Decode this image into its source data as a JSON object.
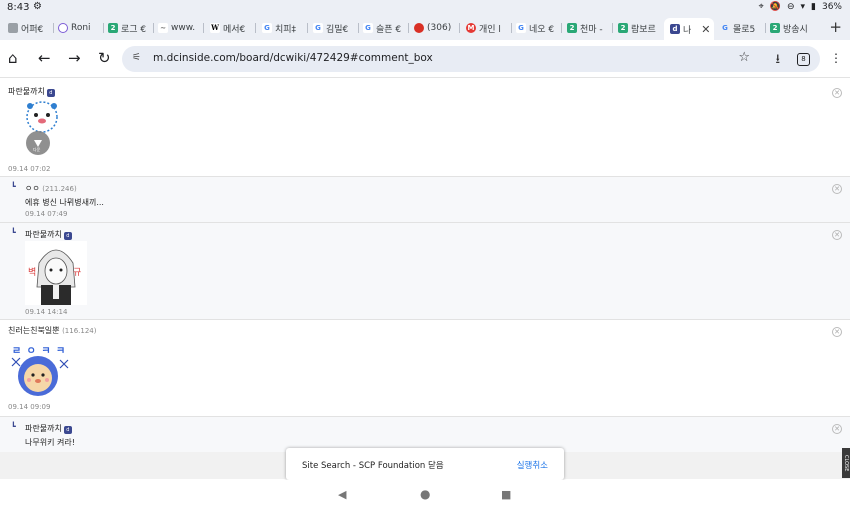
{
  "status": {
    "time": "8:43",
    "battery": "36%"
  },
  "tabs": [
    {
      "label": "어퍼€",
      "color": "#8a8a8a"
    },
    {
      "label": "Roni",
      "color": "#7c5cd6"
    },
    {
      "label": "로그 €",
      "color": "#2aa876"
    },
    {
      "label": "www.",
      "color": "#666666"
    },
    {
      "label": "메서€",
      "color": "#000000"
    },
    {
      "label": "치피‡",
      "color": "#4285f4"
    },
    {
      "label": "김밀€",
      "color": "#4285f4"
    },
    {
      "label": "슬픈 €",
      "color": "#4285f4"
    },
    {
      "label": "(306)",
      "color": "#d93025"
    },
    {
      "label": "개인 l",
      "color": "#ff5722"
    },
    {
      "label": "네오 €",
      "color": "#4285f4"
    },
    {
      "label": "천마 -",
      "color": "#2aa876"
    },
    {
      "label": "람보르",
      "color": "#2aa876"
    },
    {
      "label": "나",
      "color": "#3b4890"
    },
    {
      "label": "몰로5",
      "color": "#4285f4"
    },
    {
      "label": "방송시",
      "color": "#2aa876"
    }
  ],
  "toolbar": {
    "url": "m.dcinside.com/board/dcwiki/472429#comment_box",
    "tab_count": "8"
  },
  "comments": [
    {
      "nick": "파란물까치",
      "ip": "",
      "date": "09.14 07:02",
      "body": "",
      "reply": false
    },
    {
      "nick": "ㅇㅇ",
      "ip": "(211.246)",
      "date": "09.14 07:49",
      "body": "에휴 병신 나뮈병새끼...",
      "reply": true
    },
    {
      "nick": "파란물까치",
      "ip": "",
      "date": "09.14 14:14",
      "body": "",
      "reply": true
    },
    {
      "nick": "친러는친북일뿐",
      "ip": "(116.124)",
      "date": "09.14 09:09",
      "body": "",
      "reply": false
    },
    {
      "nick": "파란물까치",
      "ip": "",
      "date": "",
      "body": "나무위키 켜라!",
      "reply": true
    }
  ],
  "sticker_text": {
    "download": "다운",
    "third_a": "ㄹ ㅇ ㅋ ㅋ"
  },
  "toast": {
    "message": "Site Search - SCP Foundation 닫음",
    "undo": "실행취소"
  },
  "ad_close": "CLOSE"
}
